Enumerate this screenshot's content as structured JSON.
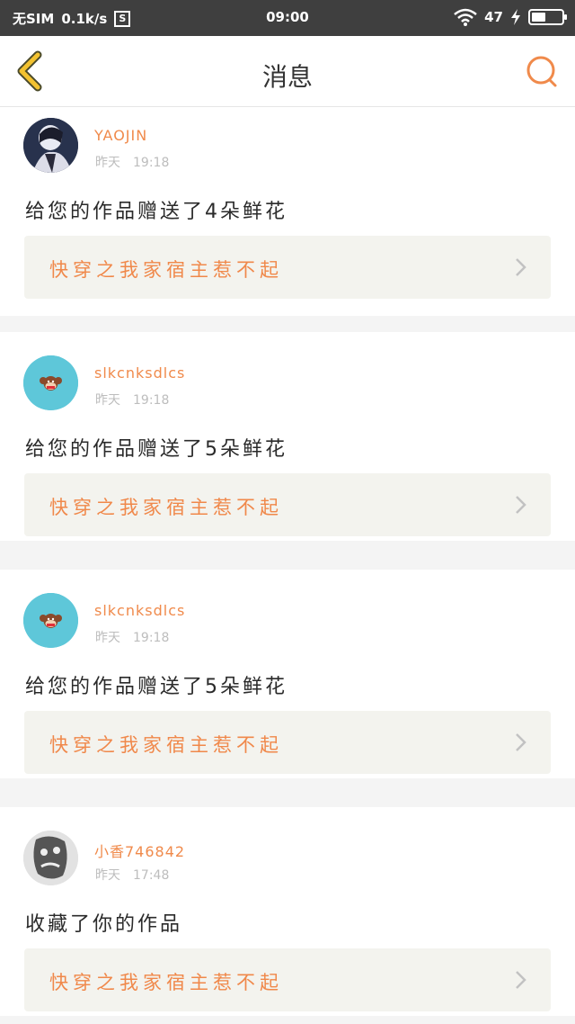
{
  "status_bar": {
    "carrier": "无SIM",
    "speed": "0.1k/s",
    "sim_icon_label": "S",
    "time": "09:00",
    "battery": "47",
    "battery_level": 0.47
  },
  "header": {
    "title": "消息",
    "back_icon": "chevron-left-icon",
    "search_icon": "search-icon"
  },
  "messages": [
    {
      "username": "YAOJIN",
      "date": "昨天",
      "time": "19:18",
      "text": "给您的作品赠送了4朵鲜花",
      "work_title": "快穿之我家宿主惹不起",
      "avatar_style": "photo-dark"
    },
    {
      "username": "slkcnksdlcs",
      "date": "昨天",
      "time": "19:18",
      "text": "给您的作品赠送了5朵鲜花",
      "work_title": "快穿之我家宿主惹不起",
      "avatar_style": "monkey-teal"
    },
    {
      "username": "slkcnksdlcs",
      "date": "昨天",
      "time": "19:18",
      "text": "给您的作品赠送了5朵鲜花",
      "work_title": "快穿之我家宿主惹不起",
      "avatar_style": "monkey-teal"
    },
    {
      "username": "小香746842",
      "date": "昨天",
      "time": "17:48",
      "text": "收藏了你的作品",
      "work_title": "快穿之我家宿主惹不起",
      "avatar_style": "sketch-face"
    }
  ],
  "colors": {
    "accent": "#f08a4b",
    "back_arrow": "#f3c230",
    "avatar_teal": "#5ec7d9"
  }
}
